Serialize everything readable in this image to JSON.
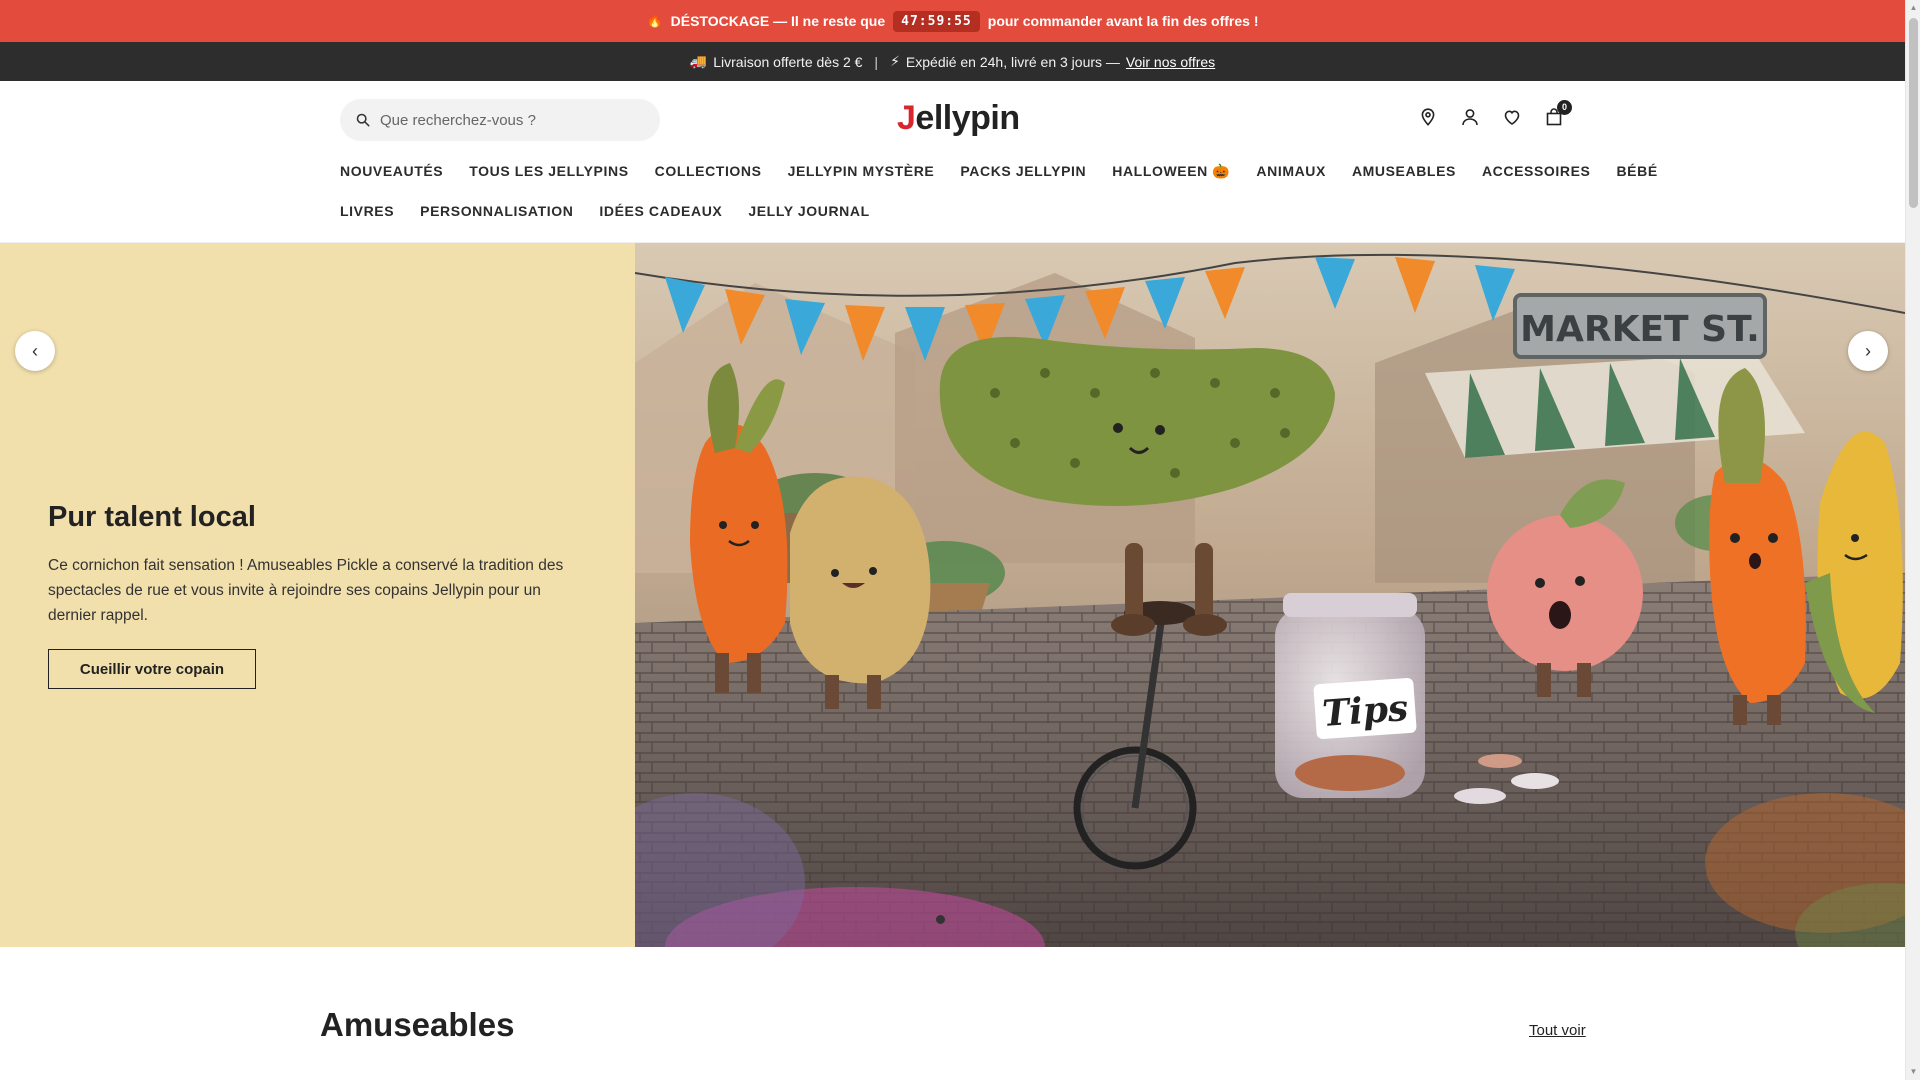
{
  "promo": {
    "emoji": "🔥",
    "text_before": "DÉSTOCKAGE — Il ne reste que",
    "countdown": "47:59:55",
    "text_after": "pour commander avant la fin des offres !"
  },
  "shipping": {
    "truck": "🚚",
    "text1": "Livraison offerte dès 2 €",
    "separator": "|",
    "bolt": "⚡",
    "text2": "Expédié en 24h, livré en 3 jours —",
    "link": "Voir nos offres"
  },
  "header": {
    "search_placeholder": "Que recherchez-vous ?",
    "logo_initial": "J",
    "logo_rest": "ellypin",
    "cart_count": "0"
  },
  "nav": {
    "row1": [
      "NOUVEAUTÉS",
      "TOUS LES JELLYPINS",
      "COLLECTIONS",
      "JELLYPIN MYSTÈRE",
      "PACKS JELLYPIN",
      "HALLOWEEN 🎃",
      "ANIMAUX",
      "AMUSEABLES",
      "ACCESSOIRES",
      "BÉBÉ"
    ],
    "row2": [
      "LIVRES",
      "PERSONNALISATION",
      "IDÉES CADEAUX",
      "JELLY JOURNAL"
    ]
  },
  "hero": {
    "title": "Pur talent local",
    "description": "Ce cornichon fait sensation ! Amuseables Pickle a conservé la tradition des spectacles de rue et vous invite à rejoindre ses copains Jellypin pour un dernier rappel.",
    "cta": "Cueillir votre copain",
    "image_sign": "MARKET ST.",
    "image_jar_label": "Tips",
    "prev_arrow": "‹",
    "next_arrow": "›"
  },
  "section": {
    "title": "Amuseables",
    "see_all": "Tout voir"
  },
  "colors": {
    "promo_bg": "#e34c3d",
    "ship_bg": "#2d2d2d",
    "hero_left_bg": "#f1dfac",
    "logo_accent": "#d7262d"
  }
}
